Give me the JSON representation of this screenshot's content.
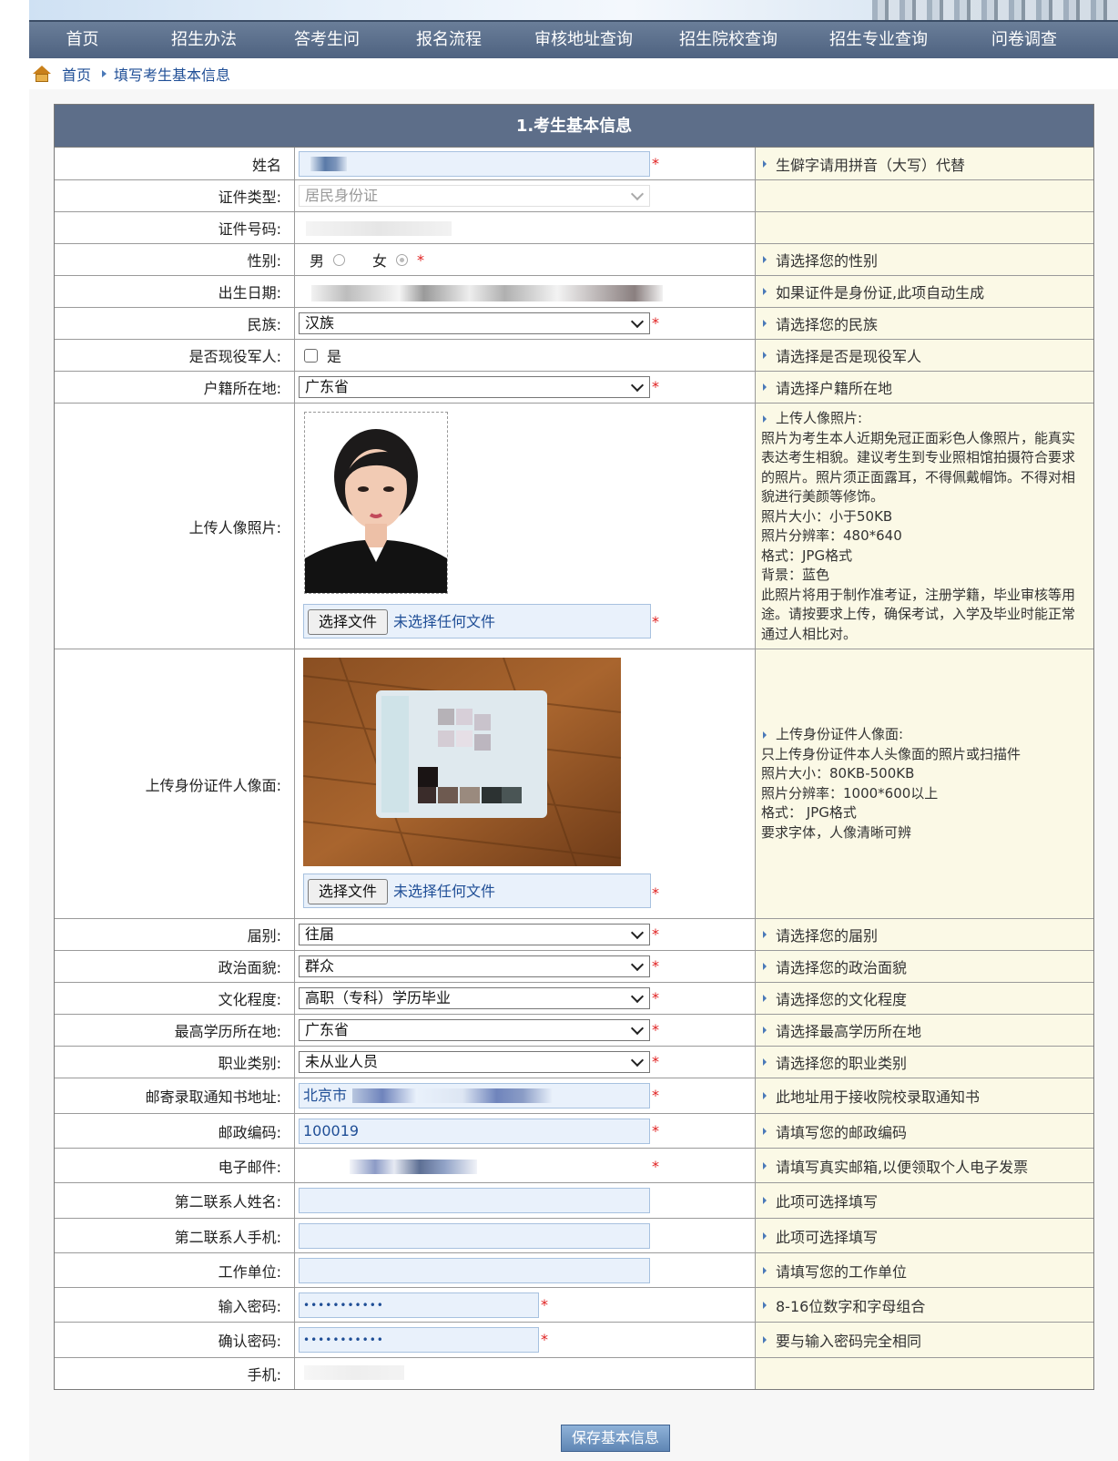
{
  "nav": [
    "首页",
    "招生办法",
    "答考生问",
    "报名流程",
    "审核地址查询",
    "招生院校查询",
    "招生专业查询",
    "问卷调查"
  ],
  "breadcrumb": {
    "home": "首页",
    "current": "填写考生基本信息"
  },
  "form_title": "1.考生基本信息",
  "required_mark": "*",
  "rows": {
    "name": {
      "label": "姓名",
      "hint": "生僻字请用拼音（大写）代替"
    },
    "id_type": {
      "label": "证件类型:",
      "value": "居民身份证"
    },
    "id_number": {
      "label": "证件号码:"
    },
    "gender": {
      "label": "性别:",
      "male": "男",
      "female": "女",
      "hint": "请选择您的性别"
    },
    "birth": {
      "label": "出生日期:",
      "hint": "如果证件是身份证,此项自动生成"
    },
    "ethnic": {
      "label": "民族:",
      "value": "汉族",
      "hint": "请选择您的民族"
    },
    "military": {
      "label": "是否现役军人:",
      "option": "是",
      "hint": "请选择是否是现役军人"
    },
    "household": {
      "label": "户籍所在地:",
      "value": "广东省",
      "hint": "请选择户籍所在地"
    },
    "photo": {
      "label": "上传人像照片:",
      "file_button": "选择文件",
      "file_status": "未选择任何文件",
      "hint_lines": [
        "上传人像照片:",
        "照片为考生本人近期免冠正面彩色人像照片，能真实",
        "表达考生相貌。建议考生到专业照相馆拍摄符合要求",
        "的照片。照片须正面露耳，不得佩戴帽饰。不得对相",
        "貌进行美颜等修饰。",
        "照片大小：小于50KB",
        "照片分辨率：480*640",
        "格式：JPG格式",
        "背景：蓝色",
        "此照片将用于制作准考证，注册学籍，毕业审核等用",
        "途。请按要求上传，确保考试，入学及毕业时能正常",
        "通过人相比对。"
      ]
    },
    "idcard": {
      "label": "上传身份证件人像面:",
      "file_button": "选择文件",
      "file_status": "未选择任何文件",
      "hint_lines": [
        "上传身份证件人像面:",
        "只上传身份证件本人头像面的照片或扫描件",
        "照片大小：80KB-500KB",
        "照片分辨率：1000*600以上",
        "格式： JPG格式",
        "要求字体，人像清晰可辨"
      ]
    },
    "session": {
      "label": "届别:",
      "value": "往届",
      "hint": "请选择您的届别"
    },
    "politics": {
      "label": "政治面貌:",
      "value": "群众",
      "hint": "请选择您的政治面貌"
    },
    "education": {
      "label": "文化程度:",
      "value": "高职（专科）学历毕业",
      "hint": "请选择您的文化程度"
    },
    "edu_place": {
      "label": "最高学历所在地:",
      "value": "广东省",
      "hint": "请选择最高学历所在地"
    },
    "occupation": {
      "label": "职业类别:",
      "value": "未从业人员",
      "hint": "请选择您的职业类别"
    },
    "address": {
      "label": "邮寄录取通知书地址:",
      "value": "北京市",
      "hint": "此地址用于接收院校录取通知书"
    },
    "postcode": {
      "label": "邮政编码:",
      "value": "100019",
      "hint": "请填写您的邮政编码"
    },
    "email": {
      "label": "电子邮件:",
      "hint": "请填写真实邮箱,以便领取个人电子发票"
    },
    "contact2_name": {
      "label": "第二联系人姓名:",
      "hint": "此项可选择填写"
    },
    "contact2_phone": {
      "label": "第二联系人手机:",
      "hint": "此项可选择填写"
    },
    "employer": {
      "label": "工作单位:",
      "hint": "请填写您的工作单位"
    },
    "password": {
      "label": "输入密码:",
      "value": "•••••••••••",
      "hint": "8-16位数字和字母组合"
    },
    "password2": {
      "label": "确认密码:",
      "value": "•••••••••••",
      "hint": "要与输入密码完全相同"
    },
    "mobile": {
      "label": "手机:"
    }
  },
  "save_button": "保存基本信息",
  "colors": {
    "nav_bg": "#5a6d8a",
    "panel_head": "#5d6e89",
    "hint_bg": "#fbf9e6",
    "input_bg": "#e9f1fb",
    "required": "#e02020",
    "link": "#1f4e96"
  }
}
